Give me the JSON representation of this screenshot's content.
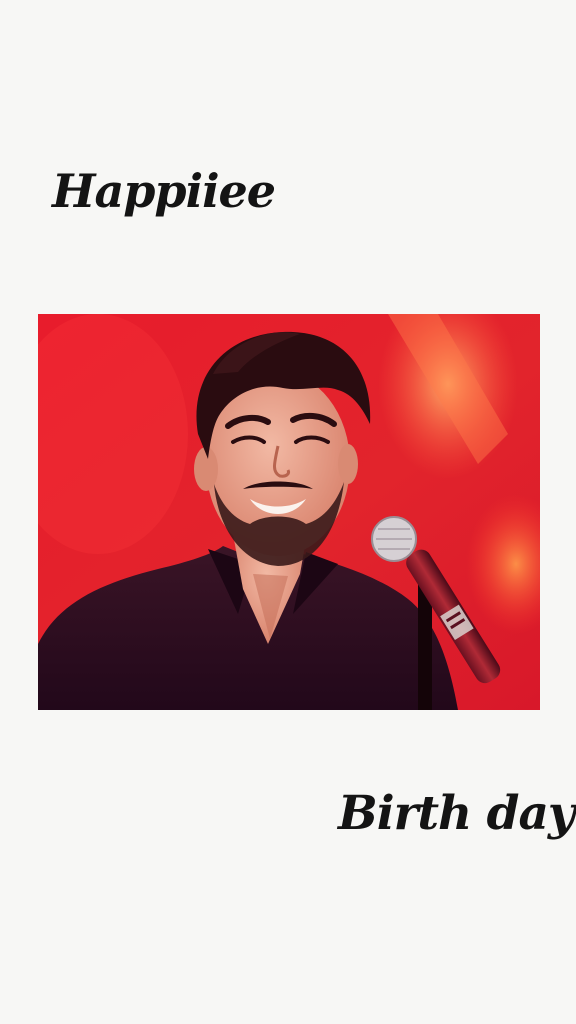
{
  "captions": {
    "top": "Happiiee",
    "bottom": "Birth day"
  },
  "photo": {
    "subject": "smiling bearded man at a microphone on a red-lit stage",
    "colors": {
      "background_light": "#f7f7f5",
      "stage_red": "#e4212b",
      "stage_orange": "#ff8a3a",
      "shirt_dark": "#2b1020",
      "hair": "#2a0c10",
      "skin": "#e8a38c"
    }
  }
}
